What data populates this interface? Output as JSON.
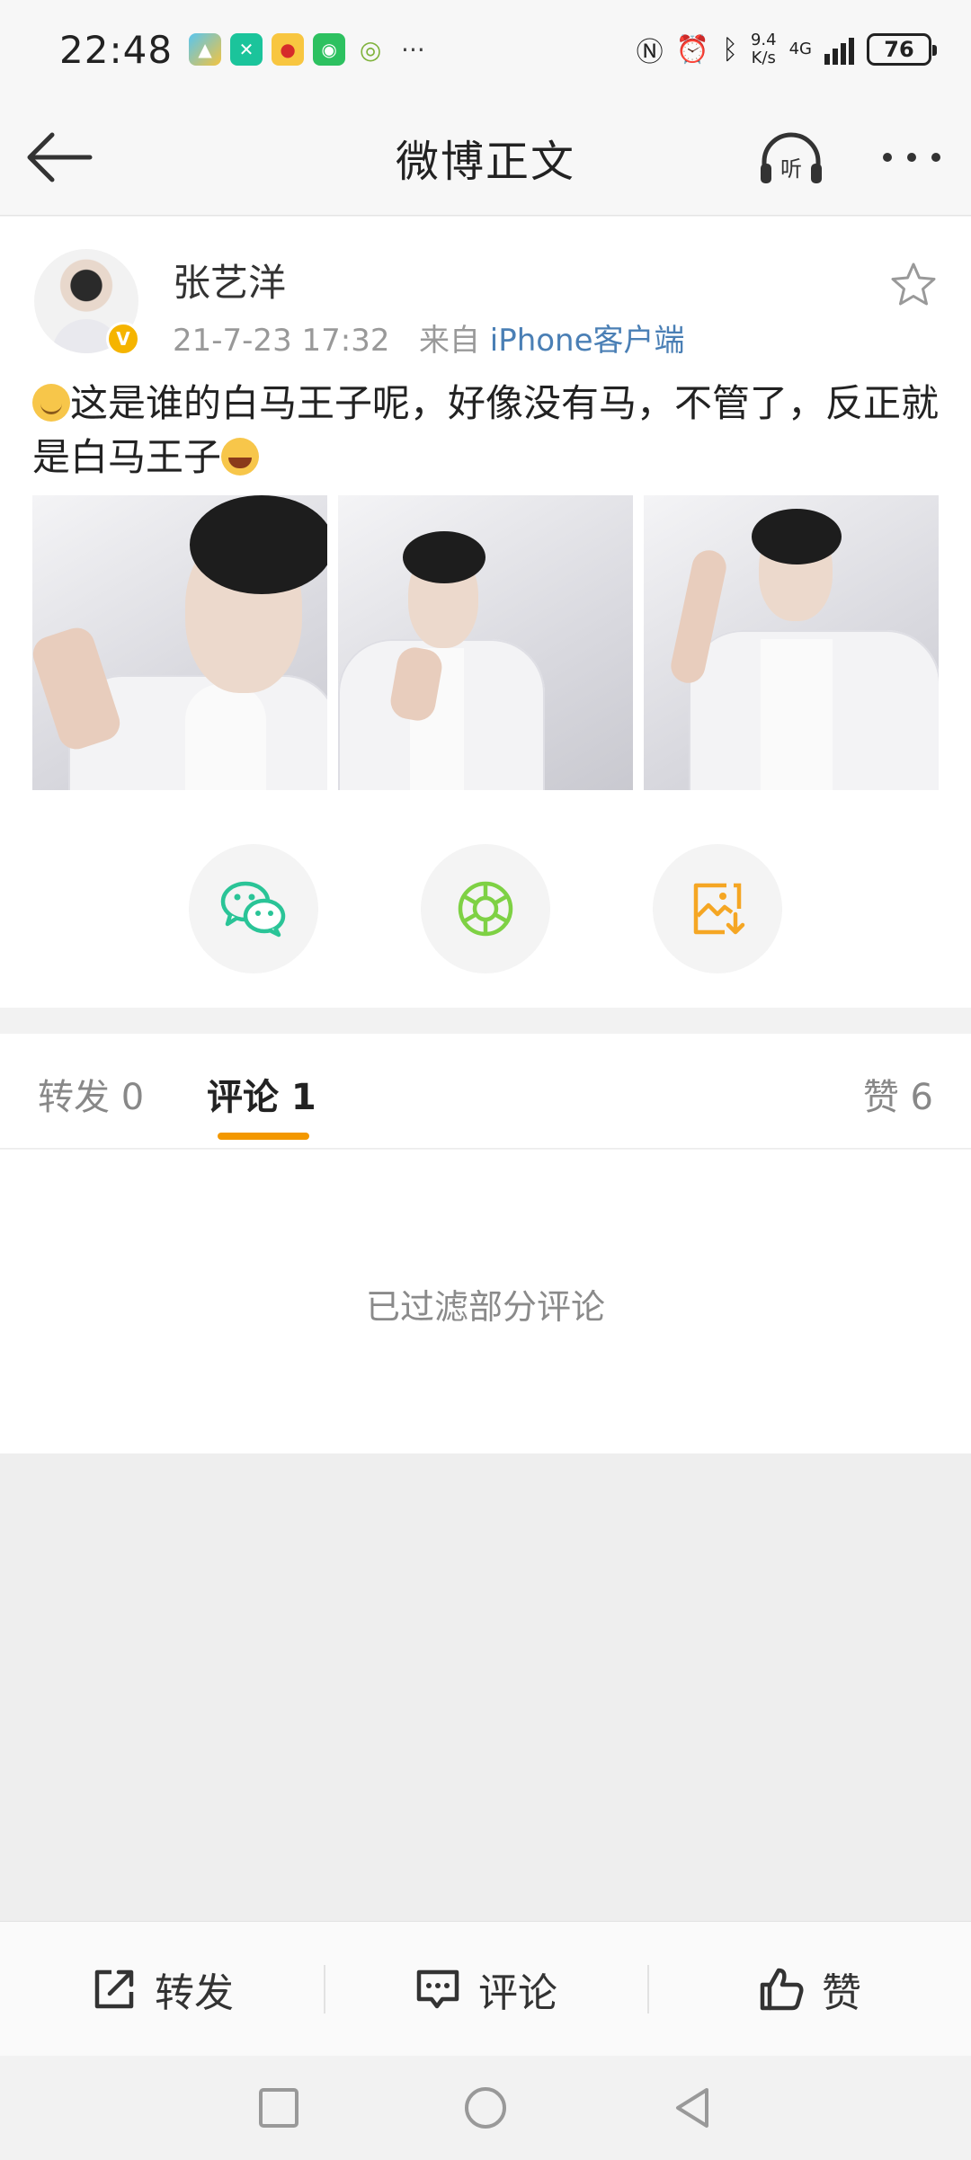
{
  "status_bar": {
    "time": "22:48",
    "net_speed_value": "9.4",
    "net_speed_unit": "K/s",
    "network_type": "4G",
    "battery": "76"
  },
  "header": {
    "title": "微博正文"
  },
  "post": {
    "username": "张艺洋",
    "date": "21-7-23 17:32",
    "source_prefix": "来自",
    "source": "iPhone客户端",
    "text_part1": "这是谁的白马王子呢，好像没有马，不管了，反正就是白马王子",
    "photo_count": 3
  },
  "tabs": {
    "repost": "转发 0",
    "comment": "评论 1",
    "like": "赞 6"
  },
  "comments": {
    "filtered_notice": "已过滤部分评论"
  },
  "actions": {
    "repost": "转发",
    "comment": "评论",
    "like": "赞"
  },
  "colors": {
    "accent": "#f39800",
    "link": "#4a7fb5",
    "verified": "#f5b400",
    "wechat": "#2ac497",
    "moments": "#7ed144",
    "save_image": "#f5a623"
  }
}
